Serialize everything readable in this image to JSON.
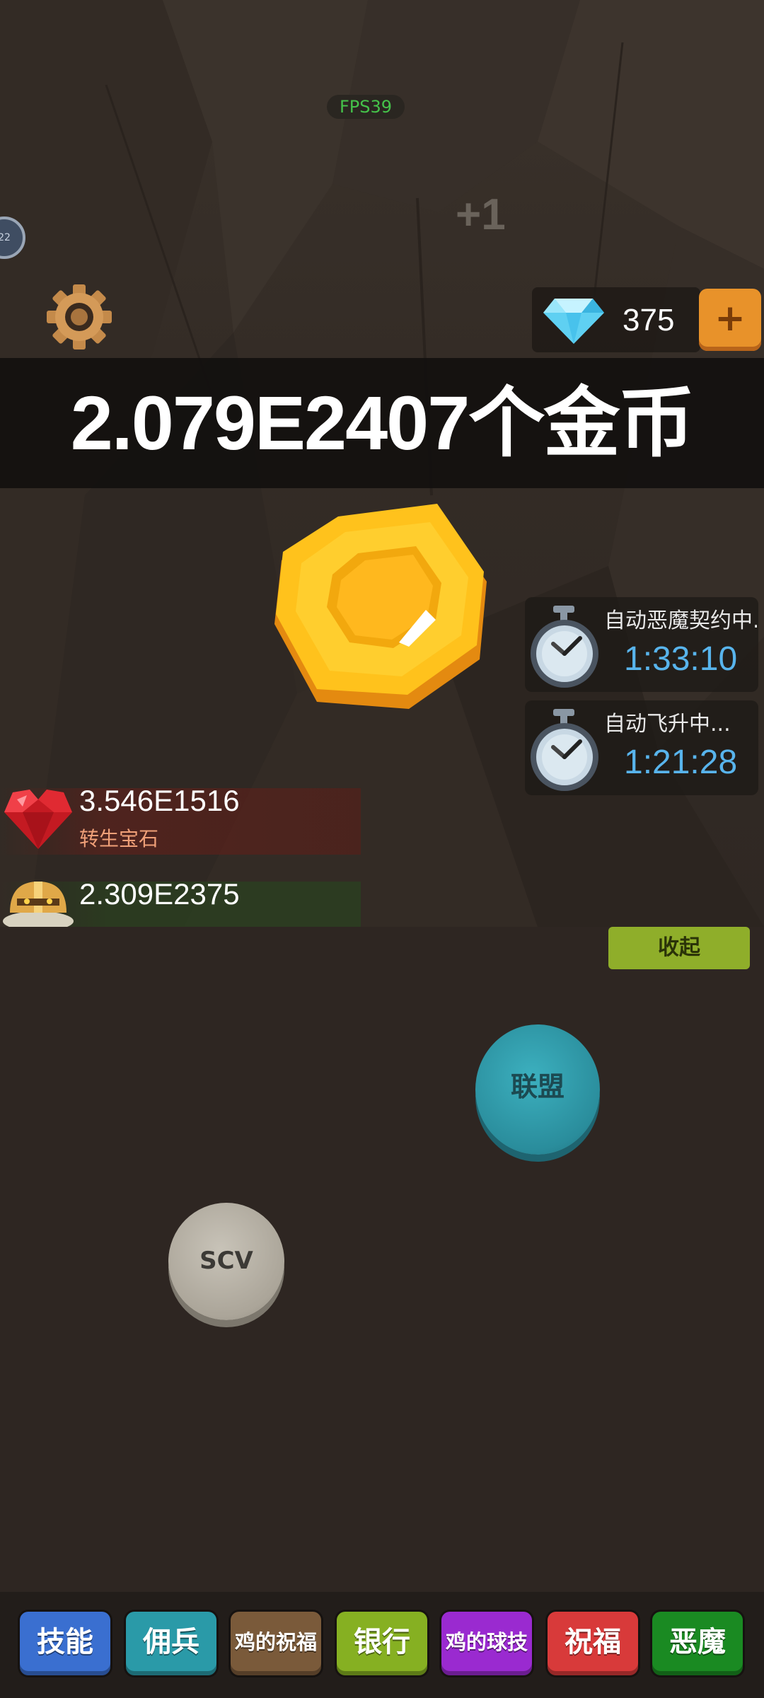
{
  "hud": {
    "fps": "FPS39",
    "floating_gain": "+1",
    "edge_badge": "22",
    "gems": "375",
    "gem_add": "+"
  },
  "banner": {
    "coins": "2.079E2407个金币"
  },
  "timers": [
    {
      "label": "自动恶魔契约中...",
      "time": "1:33:10"
    },
    {
      "label": "自动飞升中...",
      "time": "1:21:28"
    }
  ],
  "resources": {
    "rebirth_gems_value": "3.546E1516",
    "rebirth_gems_label": "转生宝石",
    "mercenary_value": "2.309E2375"
  },
  "actions": {
    "collapse": "收起",
    "alliance": "联盟",
    "scv": "SCV"
  },
  "tabs": [
    {
      "label": "技能",
      "color": "#3a6fd0"
    },
    {
      "label": "佣兵",
      "color": "#2a9aa8"
    },
    {
      "label": "鸡的祝福",
      "color": "#7a5a3a"
    },
    {
      "label": "银行",
      "color": "#86b022"
    },
    {
      "label": "鸡的球技",
      "color": "#9a2ad0"
    },
    {
      "label": "祝福",
      "color": "#d83a3a"
    },
    {
      "label": "恶魔",
      "color": "#1a8a22"
    }
  ]
}
